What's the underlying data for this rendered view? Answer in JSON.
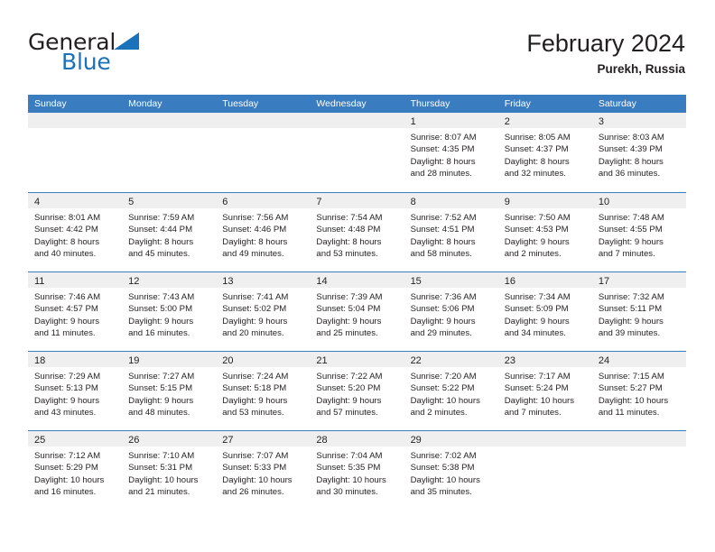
{
  "brand": {
    "name_top": "General",
    "name_bottom": "Blue",
    "triangle_color": "#1a72bb",
    "text_color": "#231f20"
  },
  "header": {
    "title": "February 2024",
    "subtitle": "Purekh, Russia"
  },
  "theme": {
    "header_blue": "#3a7cc0",
    "band_gray": "#efefef",
    "text": "#231f20"
  },
  "weekday_headers": [
    "Sunday",
    "Monday",
    "Tuesday",
    "Wednesday",
    "Thursday",
    "Friday",
    "Saturday"
  ],
  "weeks": [
    [
      {
        "day": "",
        "lines": []
      },
      {
        "day": "",
        "lines": []
      },
      {
        "day": "",
        "lines": []
      },
      {
        "day": "",
        "lines": []
      },
      {
        "day": "1",
        "lines": [
          "Sunrise: 8:07 AM",
          "Sunset: 4:35 PM",
          "Daylight: 8 hours",
          "and 28 minutes."
        ]
      },
      {
        "day": "2",
        "lines": [
          "Sunrise: 8:05 AM",
          "Sunset: 4:37 PM",
          "Daylight: 8 hours",
          "and 32 minutes."
        ]
      },
      {
        "day": "3",
        "lines": [
          "Sunrise: 8:03 AM",
          "Sunset: 4:39 PM",
          "Daylight: 8 hours",
          "and 36 minutes."
        ]
      }
    ],
    [
      {
        "day": "4",
        "lines": [
          "Sunrise: 8:01 AM",
          "Sunset: 4:42 PM",
          "Daylight: 8 hours",
          "and 40 minutes."
        ]
      },
      {
        "day": "5",
        "lines": [
          "Sunrise: 7:59 AM",
          "Sunset: 4:44 PM",
          "Daylight: 8 hours",
          "and 45 minutes."
        ]
      },
      {
        "day": "6",
        "lines": [
          "Sunrise: 7:56 AM",
          "Sunset: 4:46 PM",
          "Daylight: 8 hours",
          "and 49 minutes."
        ]
      },
      {
        "day": "7",
        "lines": [
          "Sunrise: 7:54 AM",
          "Sunset: 4:48 PM",
          "Daylight: 8 hours",
          "and 53 minutes."
        ]
      },
      {
        "day": "8",
        "lines": [
          "Sunrise: 7:52 AM",
          "Sunset: 4:51 PM",
          "Daylight: 8 hours",
          "and 58 minutes."
        ]
      },
      {
        "day": "9",
        "lines": [
          "Sunrise: 7:50 AM",
          "Sunset: 4:53 PM",
          "Daylight: 9 hours",
          "and 2 minutes."
        ]
      },
      {
        "day": "10",
        "lines": [
          "Sunrise: 7:48 AM",
          "Sunset: 4:55 PM",
          "Daylight: 9 hours",
          "and 7 minutes."
        ]
      }
    ],
    [
      {
        "day": "11",
        "lines": [
          "Sunrise: 7:46 AM",
          "Sunset: 4:57 PM",
          "Daylight: 9 hours",
          "and 11 minutes."
        ]
      },
      {
        "day": "12",
        "lines": [
          "Sunrise: 7:43 AM",
          "Sunset: 5:00 PM",
          "Daylight: 9 hours",
          "and 16 minutes."
        ]
      },
      {
        "day": "13",
        "lines": [
          "Sunrise: 7:41 AM",
          "Sunset: 5:02 PM",
          "Daylight: 9 hours",
          "and 20 minutes."
        ]
      },
      {
        "day": "14",
        "lines": [
          "Sunrise: 7:39 AM",
          "Sunset: 5:04 PM",
          "Daylight: 9 hours",
          "and 25 minutes."
        ]
      },
      {
        "day": "15",
        "lines": [
          "Sunrise: 7:36 AM",
          "Sunset: 5:06 PM",
          "Daylight: 9 hours",
          "and 29 minutes."
        ]
      },
      {
        "day": "16",
        "lines": [
          "Sunrise: 7:34 AM",
          "Sunset: 5:09 PM",
          "Daylight: 9 hours",
          "and 34 minutes."
        ]
      },
      {
        "day": "17",
        "lines": [
          "Sunrise: 7:32 AM",
          "Sunset: 5:11 PM",
          "Daylight: 9 hours",
          "and 39 minutes."
        ]
      }
    ],
    [
      {
        "day": "18",
        "lines": [
          "Sunrise: 7:29 AM",
          "Sunset: 5:13 PM",
          "Daylight: 9 hours",
          "and 43 minutes."
        ]
      },
      {
        "day": "19",
        "lines": [
          "Sunrise: 7:27 AM",
          "Sunset: 5:15 PM",
          "Daylight: 9 hours",
          "and 48 minutes."
        ]
      },
      {
        "day": "20",
        "lines": [
          "Sunrise: 7:24 AM",
          "Sunset: 5:18 PM",
          "Daylight: 9 hours",
          "and 53 minutes."
        ]
      },
      {
        "day": "21",
        "lines": [
          "Sunrise: 7:22 AM",
          "Sunset: 5:20 PM",
          "Daylight: 9 hours",
          "and 57 minutes."
        ]
      },
      {
        "day": "22",
        "lines": [
          "Sunrise: 7:20 AM",
          "Sunset: 5:22 PM",
          "Daylight: 10 hours",
          "and 2 minutes."
        ]
      },
      {
        "day": "23",
        "lines": [
          "Sunrise: 7:17 AM",
          "Sunset: 5:24 PM",
          "Daylight: 10 hours",
          "and 7 minutes."
        ]
      },
      {
        "day": "24",
        "lines": [
          "Sunrise: 7:15 AM",
          "Sunset: 5:27 PM",
          "Daylight: 10 hours",
          "and 11 minutes."
        ]
      }
    ],
    [
      {
        "day": "25",
        "lines": [
          "Sunrise: 7:12 AM",
          "Sunset: 5:29 PM",
          "Daylight: 10 hours",
          "and 16 minutes."
        ]
      },
      {
        "day": "26",
        "lines": [
          "Sunrise: 7:10 AM",
          "Sunset: 5:31 PM",
          "Daylight: 10 hours",
          "and 21 minutes."
        ]
      },
      {
        "day": "27",
        "lines": [
          "Sunrise: 7:07 AM",
          "Sunset: 5:33 PM",
          "Daylight: 10 hours",
          "and 26 minutes."
        ]
      },
      {
        "day": "28",
        "lines": [
          "Sunrise: 7:04 AM",
          "Sunset: 5:35 PM",
          "Daylight: 10 hours",
          "and 30 minutes."
        ]
      },
      {
        "day": "29",
        "lines": [
          "Sunrise: 7:02 AM",
          "Sunset: 5:38 PM",
          "Daylight: 10 hours",
          "and 35 minutes."
        ]
      },
      {
        "day": "",
        "lines": []
      },
      {
        "day": "",
        "lines": []
      }
    ]
  ]
}
